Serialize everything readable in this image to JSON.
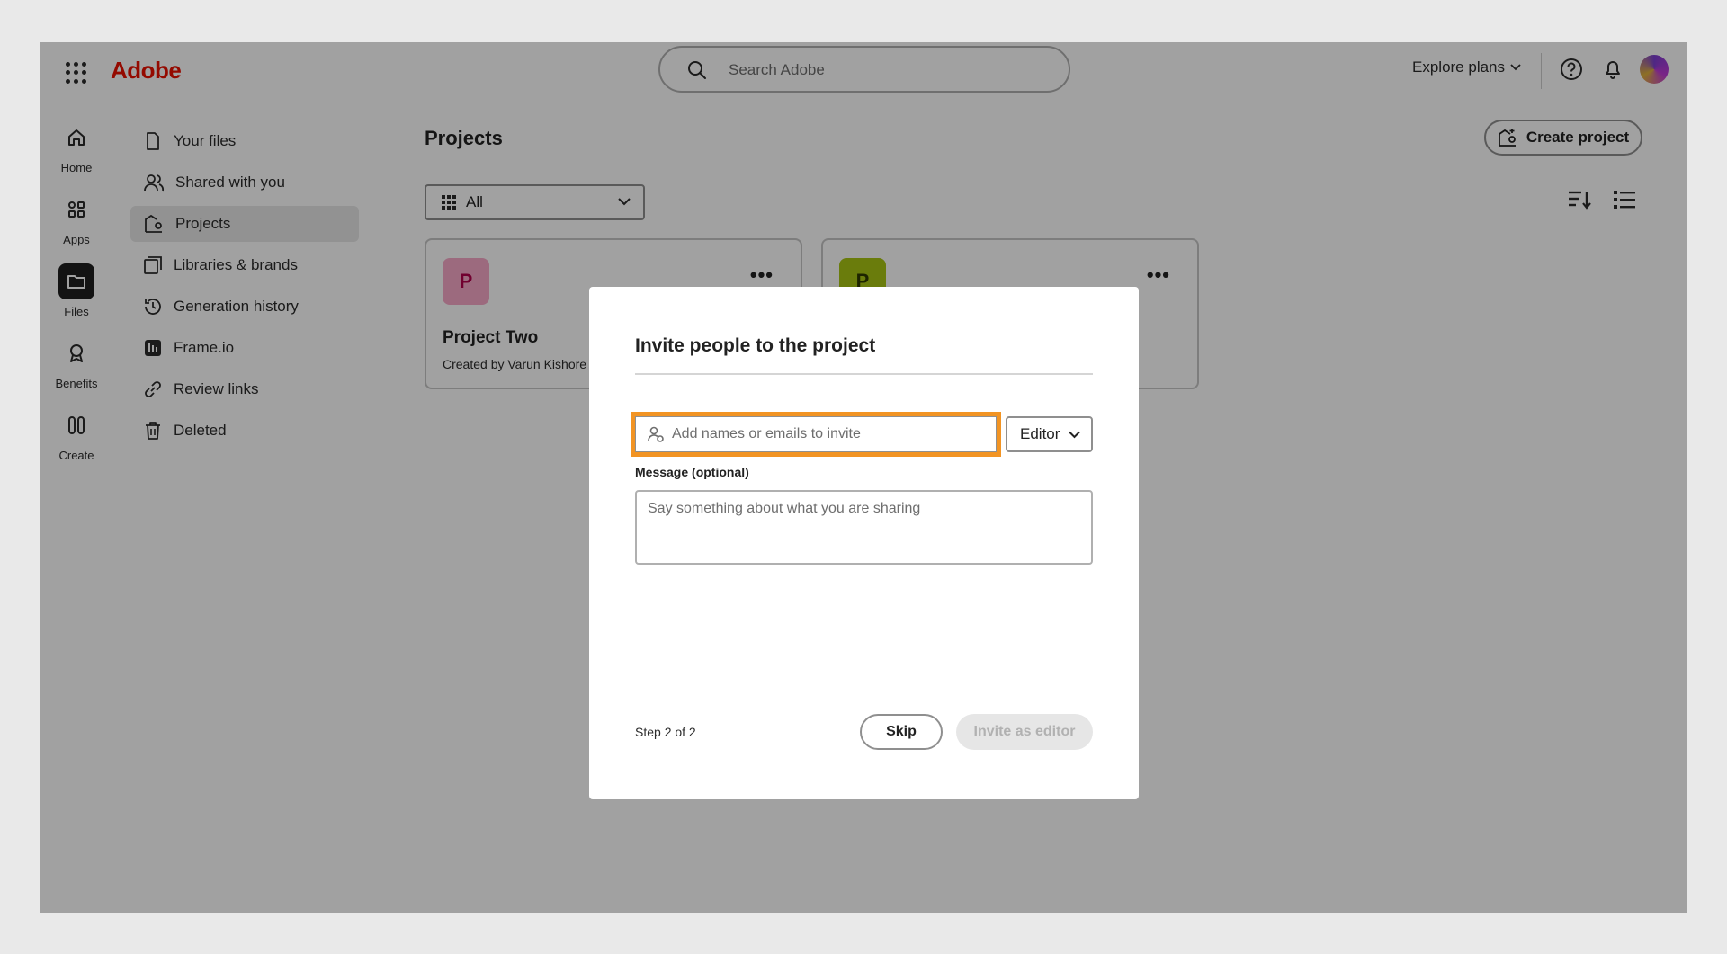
{
  "header": {
    "brand": "Adobe",
    "search_placeholder": "Search Adobe",
    "explore_label": "Explore plans",
    "icons": [
      "waffle-icon",
      "search-icon",
      "help-icon",
      "bell-icon",
      "avatar"
    ]
  },
  "rail": {
    "items": [
      {
        "label": "Home",
        "icon": "home-icon"
      },
      {
        "label": "Apps",
        "icon": "apps-icon"
      },
      {
        "label": "Files",
        "icon": "folder-icon",
        "active": true
      },
      {
        "label": "Benefits",
        "icon": "ribbon-icon"
      },
      {
        "label": "Create",
        "icon": "create-icon"
      }
    ]
  },
  "sidebar": {
    "items": [
      {
        "label": "Your files",
        "icon": "file-icon"
      },
      {
        "label": "Shared with you",
        "icon": "people-icon"
      },
      {
        "label": "Projects",
        "icon": "projects-icon",
        "active": true
      },
      {
        "label": "Libraries & brands",
        "icon": "library-icon"
      },
      {
        "label": "Generation history",
        "icon": "history-icon"
      },
      {
        "label": "Frame.io",
        "icon": "frameio-icon"
      },
      {
        "label": "Review links",
        "icon": "link-icon"
      },
      {
        "label": "Deleted",
        "icon": "trash-icon"
      }
    ]
  },
  "main": {
    "title": "Projects",
    "filter_value": "All",
    "create_label": "Create project",
    "cards": [
      {
        "badge": "P",
        "name": "Project Two",
        "created_by": "Created by Varun Kishore",
        "badge_bg": "#f8a9c8",
        "badge_fg": "#b3004b"
      },
      {
        "badge": "P",
        "name": "",
        "created_by": "",
        "badge_bg": "#a8c414",
        "badge_fg": "#2e3a00"
      }
    ]
  },
  "modal": {
    "title": "Invite people to the project",
    "invite_placeholder": "Add names or emails to invite",
    "role": "Editor",
    "message_label": "Message (optional)",
    "message_placeholder": "Say something about what you are sharing",
    "step": "Step 2 of 2",
    "skip_label": "Skip",
    "invite_label": "Invite as editor",
    "highlight_color": "#f29423"
  }
}
